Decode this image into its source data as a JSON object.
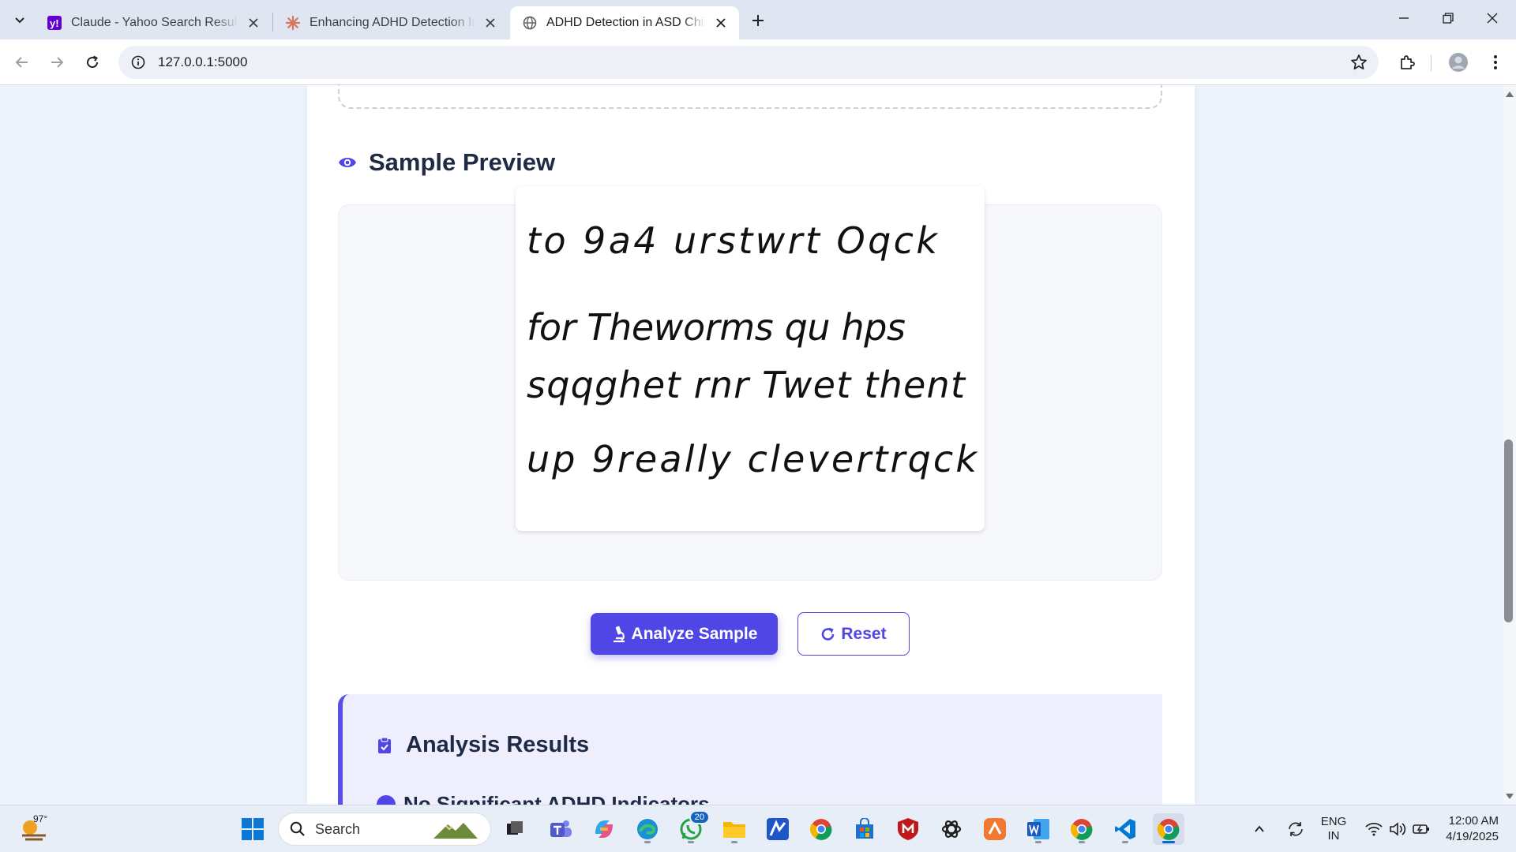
{
  "browser": {
    "tabs": [
      {
        "title": "Claude - Yahoo Search Results",
        "favicon": "yahoo-icon",
        "active": false
      },
      {
        "title": "Enhancing ADHD Detection Inte",
        "favicon": "claude-icon",
        "active": false
      },
      {
        "title": "ADHD Detection in ASD Childre",
        "favicon": "globe-icon",
        "active": true
      }
    ],
    "url": "127.0.0.1:5000"
  },
  "page": {
    "preview_heading": "Sample Preview",
    "sample_image": {
      "lines": [
        "to 9a4   urstwrt Oqck",
        "for Theworms qu hps",
        "sqqghet rnr Twet thent",
        "up 9really  clevertrqck"
      ]
    },
    "buttons": {
      "analyze": "Analyze Sample",
      "reset": "Reset"
    },
    "results_heading": "Analysis Results",
    "results_subheading": "No Significant ADHD Indicators"
  },
  "taskbar": {
    "weather_temp": "97°",
    "search_label": "Search",
    "whatsapp_badge": "20",
    "lang_line1": "ENG",
    "lang_line2": "IN",
    "time": "12:00 AM",
    "date": "4/19/2025"
  },
  "colors": {
    "accent": "#5046e5",
    "heading": "#1f2a44",
    "results_bg": "#eeeefc"
  }
}
